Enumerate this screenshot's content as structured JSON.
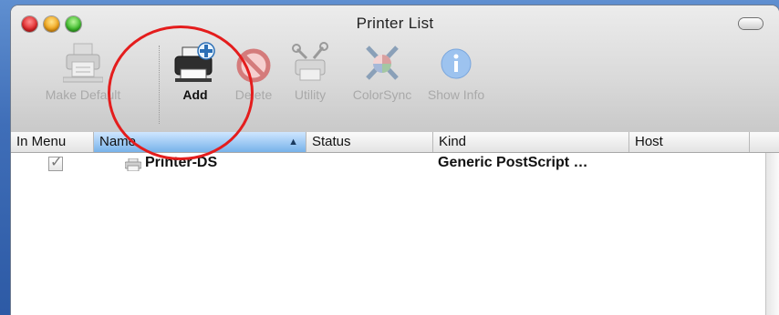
{
  "window": {
    "title": "Printer List"
  },
  "toolbar": {
    "make_default": "Make Default",
    "add": "Add",
    "delete": "Delete",
    "utility": "Utility",
    "colorsync": "ColorSync",
    "show_info": "Show Info"
  },
  "table": {
    "columns": [
      "In Menu",
      "Name",
      "Status",
      "Kind",
      "Host"
    ],
    "sorted_column": "Name",
    "rows": [
      {
        "in_menu": true,
        "name": "Printer-DS",
        "status": "",
        "kind": "Generic PostScript …",
        "host": ""
      }
    ]
  },
  "colors": {
    "highlight_circle": "#e41d1d",
    "sorted_header": "#77b2ea",
    "desktop": "#3f6eb8"
  },
  "icons": [
    "printer-default-icon",
    "printer-add-icon",
    "delete-icon",
    "utility-icon",
    "colorsync-icon",
    "info-icon"
  ]
}
